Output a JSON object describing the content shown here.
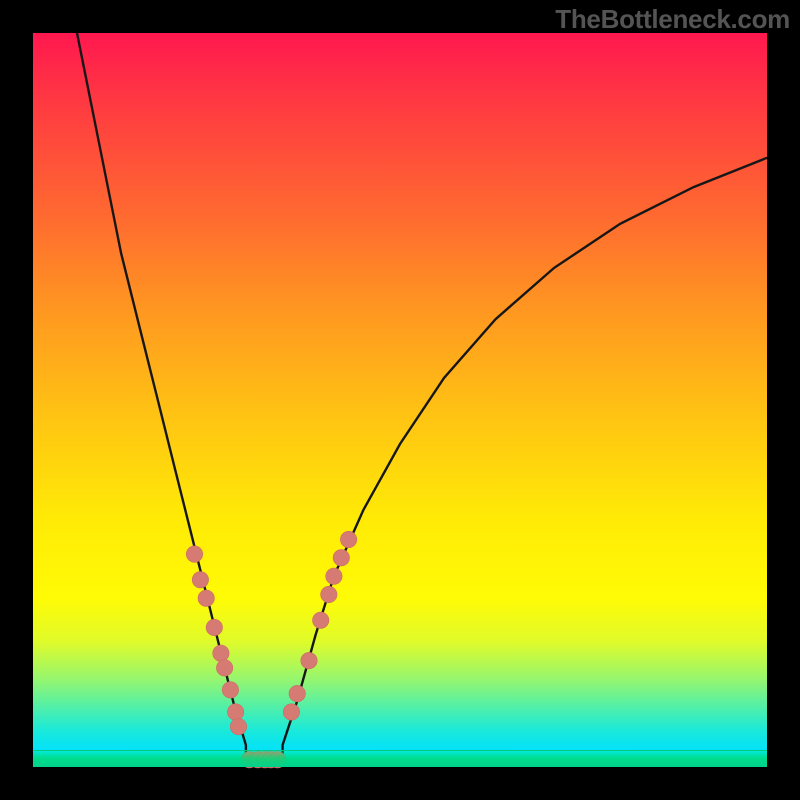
{
  "watermark": "TheBottleneck.com",
  "colors": {
    "frame": "#000000",
    "curve_stroke": "#171717",
    "dot_fill": "#d67b74",
    "dot_stroke": "#cf6a64",
    "gradient_top": "#ff184f",
    "gradient_bottom": "#00e0ff"
  },
  "chart_data": {
    "type": "line",
    "title": "",
    "xlabel": "",
    "ylabel": "",
    "xlim": [
      0,
      100
    ],
    "ylim": [
      0,
      100
    ],
    "grid": false,
    "legend": false,
    "curve": {
      "left": [
        {
          "x": 6,
          "y": 100
        },
        {
          "x": 8,
          "y": 90
        },
        {
          "x": 10,
          "y": 80
        },
        {
          "x": 12,
          "y": 70
        },
        {
          "x": 14.5,
          "y": 60
        },
        {
          "x": 17,
          "y": 50
        },
        {
          "x": 19.5,
          "y": 40
        },
        {
          "x": 22,
          "y": 30
        },
        {
          "x": 24,
          "y": 22
        },
        {
          "x": 26,
          "y": 14
        },
        {
          "x": 27.5,
          "y": 8
        },
        {
          "x": 29,
          "y": 3
        }
      ],
      "flat": [
        {
          "x": 29,
          "y": 0.9
        },
        {
          "x": 34,
          "y": 0.9
        }
      ],
      "right": [
        {
          "x": 34,
          "y": 3
        },
        {
          "x": 36,
          "y": 9
        },
        {
          "x": 38.5,
          "y": 18
        },
        {
          "x": 41,
          "y": 26
        },
        {
          "x": 45,
          "y": 35
        },
        {
          "x": 50,
          "y": 44
        },
        {
          "x": 56,
          "y": 53
        },
        {
          "x": 63,
          "y": 61
        },
        {
          "x": 71,
          "y": 68
        },
        {
          "x": 80,
          "y": 74
        },
        {
          "x": 90,
          "y": 79
        },
        {
          "x": 100,
          "y": 83
        }
      ]
    },
    "dots": [
      {
        "x": 22.0,
        "y": 29.0
      },
      {
        "x": 22.8,
        "y": 25.5
      },
      {
        "x": 23.6,
        "y": 23.0
      },
      {
        "x": 24.7,
        "y": 19.0
      },
      {
        "x": 25.6,
        "y": 15.5
      },
      {
        "x": 26.1,
        "y": 13.5
      },
      {
        "x": 26.9,
        "y": 10.5
      },
      {
        "x": 27.6,
        "y": 7.5
      },
      {
        "x": 28.0,
        "y": 5.5
      },
      {
        "x": 29.5,
        "y": 1.0
      },
      {
        "x": 30.6,
        "y": 1.0
      },
      {
        "x": 31.6,
        "y": 1.0
      },
      {
        "x": 32.4,
        "y": 1.0
      },
      {
        "x": 33.3,
        "y": 1.0
      },
      {
        "x": 35.2,
        "y": 7.5
      },
      {
        "x": 36.0,
        "y": 10.0
      },
      {
        "x": 37.6,
        "y": 14.5
      },
      {
        "x": 39.2,
        "y": 20.0
      },
      {
        "x": 40.3,
        "y": 23.5
      },
      {
        "x": 41.0,
        "y": 26.0
      },
      {
        "x": 42.0,
        "y": 28.5
      },
      {
        "x": 43.0,
        "y": 31.0
      }
    ]
  }
}
